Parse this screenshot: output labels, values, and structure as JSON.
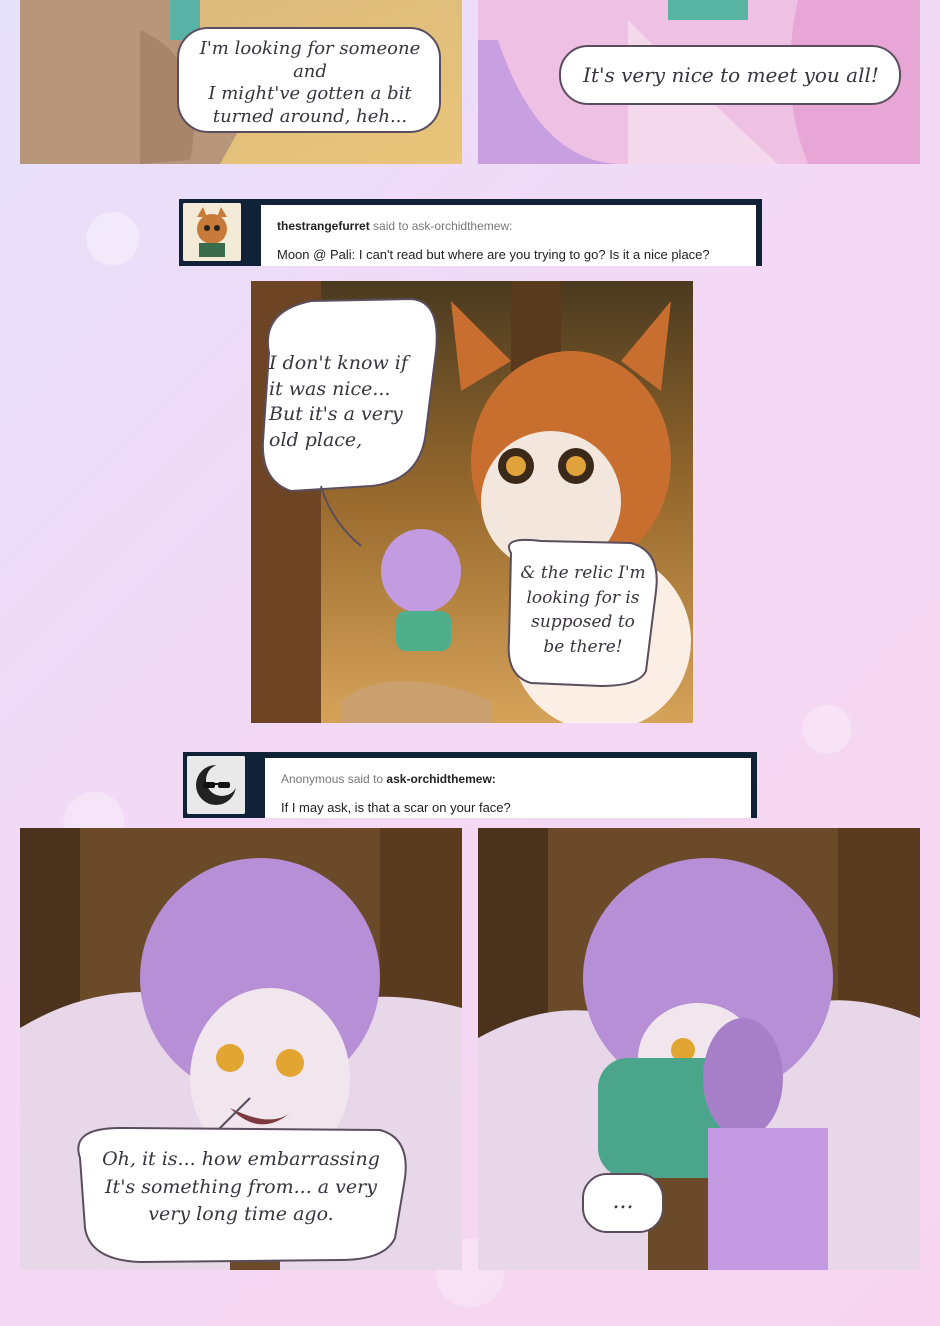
{
  "panels": {
    "top_left_text": [
      "I'm looking for someone and",
      "I might've gotten a bit",
      "turned around, heh..."
    ],
    "top_right_text": [
      "It's very nice to meet you all!"
    ],
    "middle_left_text": [
      "I don't know if",
      "it was nice...",
      "But it's a very",
      "old place,"
    ],
    "middle_right_text": [
      "& the relic I'm",
      "looking for is",
      "supposed to",
      "be there!"
    ],
    "bottom_left_text": [
      "Oh, it is... how embarrassing",
      "It's something from... a very",
      "very long time ago."
    ],
    "bottom_right_text": [
      "..."
    ]
  },
  "asks": [
    {
      "user": "thestrangefurret",
      "said_to": "said to",
      "target": "ask-orchidthemew:",
      "question": "Moon @ Pali: I can't read but where are you trying to go? Is it a nice place?"
    },
    {
      "user": "Anonymous",
      "said_to": "said to",
      "target": "ask-orchidthemew:",
      "question": "If I may ask, is that a scar on your face?"
    }
  ]
}
